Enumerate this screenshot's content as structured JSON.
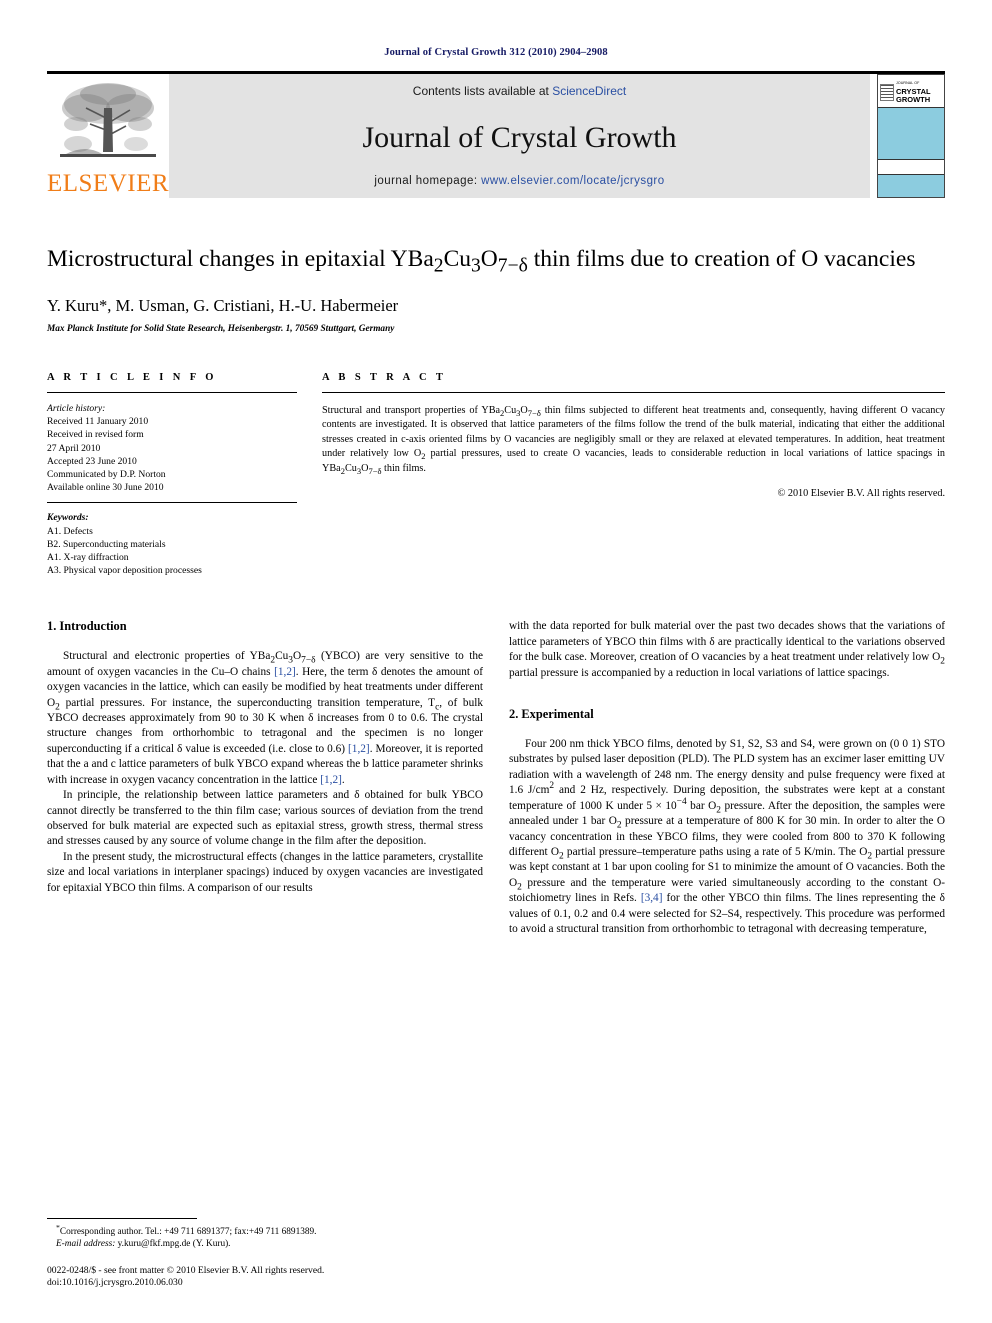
{
  "running_head": "Journal of Crystal Growth 312 (2010) 2904–2908",
  "masthead": {
    "publisher_name": "ELSEVIER",
    "contents_prefix": "Contents lists available at ",
    "contents_link": "ScienceDirect",
    "journal_title": "Journal of Crystal Growth",
    "homepage_prefix": "journal homepage: ",
    "homepage_url": "www.elsevier.com/locate/jcrysgro",
    "cover_title_line1": "CRYSTAL",
    "cover_title_line2": "GROWTH",
    "cover_title_tiny": "JOURNAL OF",
    "cover_band_color": "#8cccdf",
    "brand_color": "#f07d18",
    "link_color": "#2a4fa2"
  },
  "article": {
    "title_part1": "Microstructural changes in epitaxial YBa",
    "title_sub1": "2",
    "title_part2": "Cu",
    "title_sub2": "3",
    "title_part3": "O",
    "title_sub3": "7−δ",
    "title_part4": " thin films due to creation of O vacancies",
    "authors": "Y. Kuru*, M. Usman, G. Cristiani, H.-U. Habermeier",
    "affiliation": "Max Planck Institute for Solid State Research, Heisenbergstr. 1, 70569 Stuttgart, Germany"
  },
  "info": {
    "heading": "A R T I C L E   I N F O",
    "history_label": "Article history:",
    "history": [
      "Received 11 January 2010",
      "Received in revised form",
      "27 April 2010",
      "Accepted 23 June 2010",
      "Communicated by D.P. Norton",
      "Available online 30 June 2010"
    ],
    "keywords_label": "Keywords:",
    "keywords": [
      "A1. Defects",
      "B2. Superconducting materials",
      "A1. X-ray diffraction",
      "A3. Physical vapor deposition processes"
    ]
  },
  "abstract": {
    "heading": "A B S T R A C T",
    "text_a": "Structural and transport properties of YBa",
    "text_b": "2",
    "text_c": "Cu",
    "text_d": "3",
    "text_e": "O",
    "text_f": "7−δ",
    "text_g": " thin films subjected to different heat treatments and, consequently, having different O vacancy contents are investigated. It is observed that lattice parameters of the films follow the trend of the bulk material, indicating that either the additional stresses created in c-axis oriented films by O vacancies are negligibly small or they are relaxed at elevated temperatures. In addition, heat treatment under relatively low O",
    "text_h": "2",
    "text_i": " partial pressures, used to create O vacancies, leads to considerable reduction in local variations of lattice spacings in YBa",
    "text_j": "2",
    "text_k": "Cu",
    "text_l": "3",
    "text_m": "O",
    "text_n": "7−δ",
    "text_o": " thin films.",
    "copyright": "© 2010 Elsevier B.V. All rights reserved."
  },
  "sections": {
    "intro_heading": "1. Introduction",
    "intro_p1_a": "Structural and electronic properties of YBa",
    "intro_p1_b": "2",
    "intro_p1_c": "Cu",
    "intro_p1_d": "3",
    "intro_p1_e": "O",
    "intro_p1_f": "7−δ",
    "intro_p1_g": " (YBCO) are very sensitive to the amount of oxygen vacancies in the Cu–O chains ",
    "intro_p1_cite1": "[1,2]",
    "intro_p1_h": ". Here, the term δ denotes the amount of oxygen vacancies in the lattice, which can easily be modified by heat treatments under different O",
    "intro_p1_i": "2",
    "intro_p1_j": " partial pressures. For instance, the superconducting transition temperature, T",
    "intro_p1_k": "c",
    "intro_p1_l": ", of bulk YBCO decreases approximately from 90 to 30 K when δ increases from 0 to 0.6. The crystal structure changes from orthorhombic to tetragonal and the specimen is no longer superconducting if a critical δ value is exceeded (i.e. close to 0.6) ",
    "intro_p1_cite2": "[1,2]",
    "intro_p1_m": ". Moreover, it is reported that the a and c lattice parameters of bulk YBCO expand whereas the b lattice parameter shrinks with increase in oxygen vacancy concentration in the lattice ",
    "intro_p1_cite3": "[1,2]",
    "intro_p1_n": ".",
    "intro_p2": "In principle, the relationship between lattice parameters and δ obtained for bulk YBCO cannot directly be transferred to the thin film case; various sources of deviation from the trend observed for bulk material are expected such as epitaxial stress, growth stress, thermal stress and stresses caused by any source of volume change in the film after the deposition.",
    "intro_p3": "In the present study, the microstructural effects (changes in the lattice parameters, crystallite size and local variations in interplaner spacings) induced by oxygen vacancies are investigated for epitaxial YBCO thin films. A comparison of our results",
    "intro_p3_cont_a": "with the data reported for bulk material over the past two decades shows that the variations of lattice parameters of YBCO thin films with δ are practically identical to the variations observed for the bulk case. Moreover, creation of O vacancies by a heat treatment under relatively low O",
    "intro_p3_cont_b": "2",
    "intro_p3_cont_c": " partial pressure is accompanied by a reduction in local variations of lattice spacings.",
    "exp_heading": "2. Experimental",
    "exp_p1_a": "Four 200 nm thick YBCO films, denoted by S1, S2, S3 and S4, were grown on (0 0 1) STO substrates by pulsed laser deposition (PLD). The PLD system has an excimer laser emitting UV radiation with a wavelength of 248 nm. The energy density and pulse frequency were fixed at 1.6 J/cm",
    "exp_p1_b": "2",
    "exp_p1_c": " and 2 Hz, respectively. During deposition, the substrates were kept at a constant temperature of 1000 K under 5 × 10",
    "exp_p1_d": "−4",
    "exp_p1_e": " bar O",
    "exp_p1_f": "2",
    "exp_p1_g": " pressure. After the deposition, the samples were annealed under 1 bar O",
    "exp_p1_h": "2",
    "exp_p1_i": " pressure at a temperature of 800 K for 30 min. In order to alter the O vacancy concentration in these YBCO films, they were cooled from 800 to 370 K following different O",
    "exp_p1_j": "2",
    "exp_p1_k": " partial pressure–temperature paths using a rate of 5 K/min. The O",
    "exp_p1_l": "2",
    "exp_p1_m": " partial pressure was kept constant at 1 bar upon cooling for S1 to minimize the amount of O vacancies. Both the O",
    "exp_p1_n": "2",
    "exp_p1_o": " pressure and the temperature were varied simultaneously according to the constant O-stoichiometry lines in Refs. ",
    "exp_p1_cite": "[3,4]",
    "exp_p1_p": " for the other YBCO thin films. The lines representing the δ values of 0.1, 0.2 and 0.4 were selected for S2–S4, respectively. This procedure was performed to avoid a structural transition from orthorhombic to tetragonal with decreasing temperature,"
  },
  "footnote": {
    "corresponding": "Corresponding author. Tel.: +49 711 6891377; fax:+49 711 6891389.",
    "email_label": "E-mail address:",
    "email_value": " y.kuru@fkf.mpg.de (Y. Kuru).",
    "issn_line": "0022-0248/$ - see front matter © 2010 Elsevier B.V. All rights reserved.",
    "doi_line": "doi:10.1016/j.jcrysgro.2010.06.030"
  }
}
